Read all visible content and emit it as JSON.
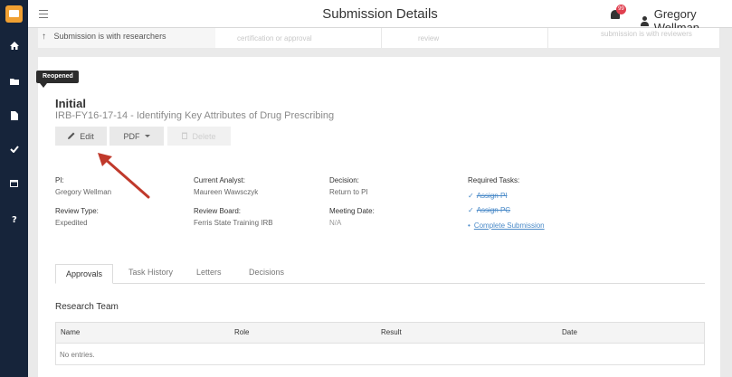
{
  "header": {
    "title": "Submission Details",
    "notification_count": "99",
    "user_name": "Gregory Wellman"
  },
  "steps": [
    {
      "label": "Submission is with researchers"
    },
    {
      "label": "certification or approval"
    },
    {
      "label": "review"
    },
    {
      "label": "submission is with reviewers"
    }
  ],
  "submission": {
    "status_badge": "Reopened",
    "heading": "Initial",
    "subtitle": "IRB-FY16-17-14 - Identifying Key Attributes of Drug Prescribing"
  },
  "actions": {
    "edit": "Edit",
    "pdf": "PDF",
    "delete": "Delete"
  },
  "details": {
    "pi_label": "PI:",
    "pi_value": "Gregory Wellman",
    "analyst_label": "Current Analyst:",
    "analyst_value": "Maureen Wawsczyk",
    "decision_label": "Decision:",
    "decision_value": "Return to PI",
    "review_type_label": "Review Type:",
    "review_type_value": "Expedited",
    "review_board_label": "Review Board:",
    "review_board_value": "Ferris State Training IRB",
    "meeting_label": "Meeting Date:",
    "meeting_value": "N/A",
    "tasks_label": "Required Tasks:",
    "tasks": [
      {
        "label": "Assign PI",
        "done": true
      },
      {
        "label": "Assign PC",
        "done": true
      },
      {
        "label": "Complete Submission",
        "done": false
      }
    ]
  },
  "tabs": [
    "Approvals",
    "Task History",
    "Letters",
    "Decisions"
  ],
  "research_team": {
    "title": "Research Team",
    "columns": [
      "Name",
      "Role",
      "Result",
      "Date"
    ],
    "empty_text": "No entries."
  },
  "colors": {
    "nav": "#16243a",
    "link": "#4a8ac8",
    "arrow": "#c0392b",
    "badge": "#e04050"
  }
}
